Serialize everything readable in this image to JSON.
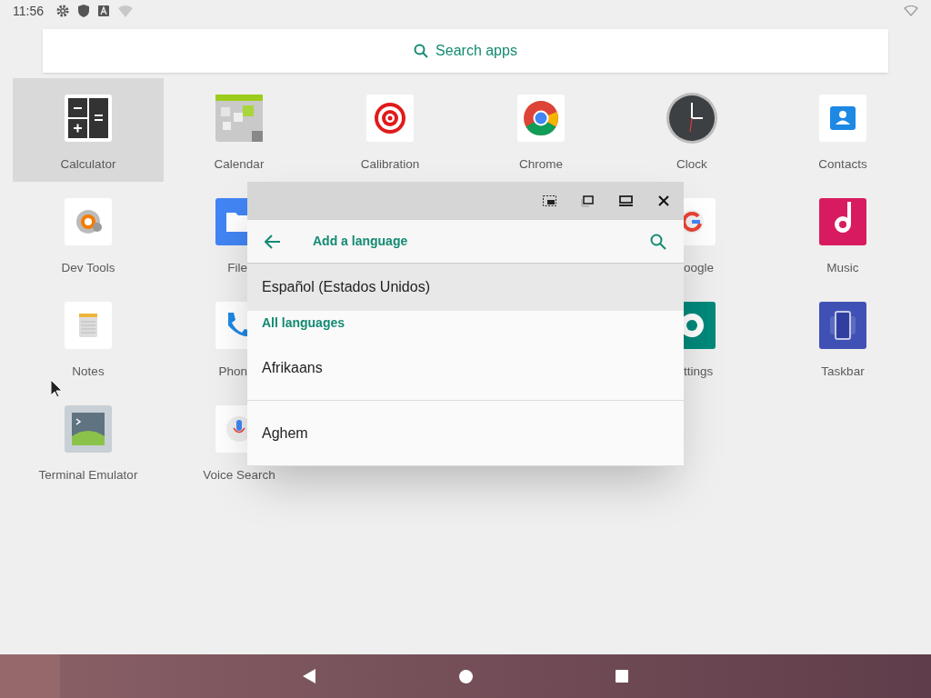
{
  "status_bar": {
    "time": "11:56"
  },
  "search": {
    "placeholder": "Search apps"
  },
  "app_rows": [
    {
      "left": [
        {
          "label": "Calculator",
          "selected": true,
          "kind": "full"
        },
        {
          "label": "Calendar",
          "selected": false,
          "kind": "full"
        },
        {
          "label": "Calibration",
          "selected": false,
          "kind": "full"
        },
        {
          "label": "Chrome",
          "selected": false,
          "kind": "full"
        },
        {
          "label": "Clock",
          "selected": false,
          "kind": "full"
        },
        {
          "label": "Contacts",
          "selected": false,
          "kind": "full"
        }
      ],
      "right": []
    },
    {
      "left": [
        {
          "label": "Dev Tools",
          "selected": false,
          "kind": "full"
        },
        {
          "label": "File",
          "selected": false,
          "kind": "partial"
        }
      ],
      "right": [
        {
          "label": "oogle",
          "selected": false,
          "kind": "partial"
        },
        {
          "label": "Music",
          "selected": false,
          "kind": "full"
        }
      ]
    },
    {
      "left": [
        {
          "label": "Notes",
          "selected": false,
          "kind": "full"
        },
        {
          "label": "Phon",
          "selected": false,
          "kind": "partial"
        }
      ],
      "right": [
        {
          "label": "ttings",
          "selected": false,
          "kind": "partial"
        },
        {
          "label": "Taskbar",
          "selected": false,
          "kind": "full"
        }
      ]
    },
    {
      "left": [
        {
          "label": "Terminal Emulator",
          "selected": false,
          "kind": "full"
        },
        {
          "label": "Voice Search",
          "selected": false,
          "kind": "full"
        }
      ],
      "right": []
    }
  ],
  "window": {
    "title": "Add a language",
    "items": [
      {
        "kind": "suggested",
        "label": "Español (Estados Unidos)"
      },
      {
        "kind": "header",
        "label": "All languages"
      },
      {
        "kind": "language",
        "label": "Afrikaans"
      },
      {
        "kind": "language",
        "label": "Aghem"
      }
    ]
  }
}
